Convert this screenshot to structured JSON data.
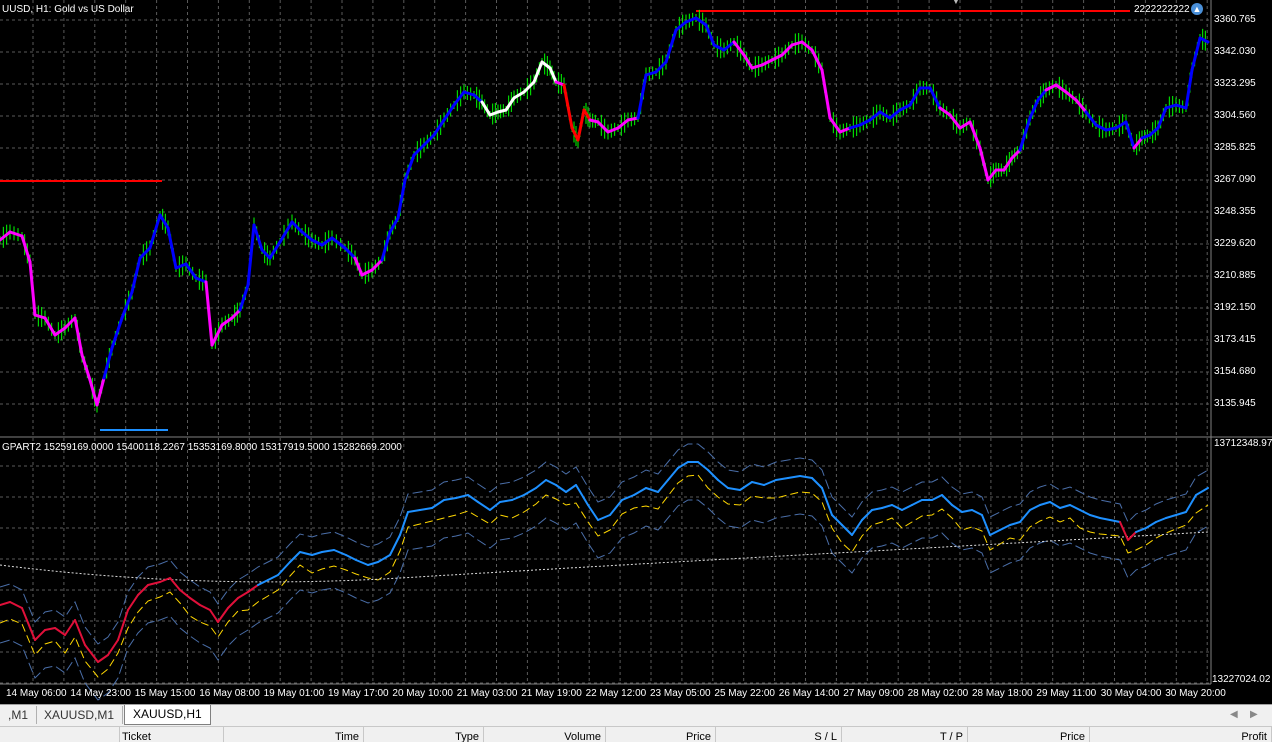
{
  "chart": {
    "title": "UUSD, H1:  Gold vs US Dollar",
    "price_labels": [
      "3360.765",
      "3342.030",
      "3323.295",
      "3304.560",
      "3285.825",
      "3267.090",
      "3248.355",
      "3229.620",
      "3210.885",
      "3192.150",
      "3173.415",
      "3154.680",
      "3135.945"
    ],
    "top_line_label": "2222222222",
    "indicator_title": "GPART2 15259169.0000 15400118.2267 15353169.8000 15317919.5000 15282669.2000",
    "indicator_top_label": "13712348.97",
    "indicator_bottom_label": "13227024.02",
    "date_labels": [
      "14 May 06:00",
      "14 May 23:00",
      "15 May 15:00",
      "16 May 08:00",
      "19 May 01:00",
      "19 May 17:00",
      "20 May 10:00",
      "21 May 03:00",
      "21 May 19:00",
      "22 May 12:00",
      "23 May 05:00",
      "25 May 22:00",
      "26 May 14:00",
      "27 May 09:00",
      "28 May 02:00",
      "28 May 18:00",
      "29 May 11:00",
      "30 May 04:00",
      "30 May 20:00"
    ],
    "colors": {
      "background": "#000000",
      "grid": "#5a5a5a",
      "candle_up": "#00ff00",
      "candle_down": "#00ff00",
      "trend_up": "#0000ff",
      "trend_down": "#ff00ff",
      "trend_neutral": "#ffffff",
      "trend_alt": "#ff0000",
      "level_line": "#ff0000",
      "low_level_line": "#1e90ff",
      "indicator_main": "#1e90ff",
      "indicator_down": "#e0103a",
      "indicator_mid": "#ffd700"
    }
  },
  "tabs": [
    {
      "label": ",M1",
      "active": false
    },
    {
      "label": "XAUUSD,M1",
      "active": false
    },
    {
      "label": "XAUUSD,H1",
      "active": true
    }
  ],
  "columns": [
    "Ticket",
    "Time",
    "Type",
    "Volume",
    "Price",
    "S / L",
    "T / P",
    "Price",
    "Profit"
  ],
  "scroll_left": "◀",
  "scroll_right": "▶"
}
